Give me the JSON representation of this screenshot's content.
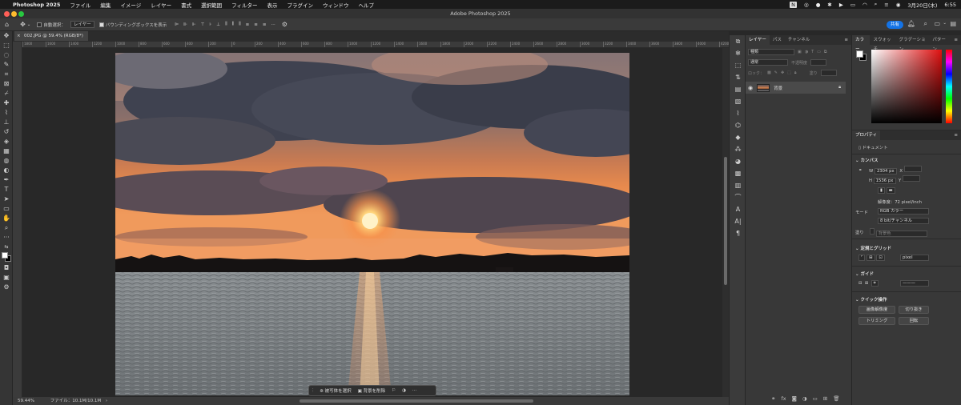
{
  "menubar": {
    "apple": "",
    "app": "Photoshop 2025",
    "items": [
      "ファイル",
      "編集",
      "イメージ",
      "レイヤー",
      "書式",
      "選択範囲",
      "フィルター",
      "表示",
      "プラグイン",
      "ウィンドウ",
      "ヘルプ"
    ],
    "date": "3月20日(木)",
    "time": "6:55"
  },
  "window": {
    "title": "Adobe Photoshop 2025"
  },
  "options": {
    "auto_select_label": "自動選択：",
    "layer_dropdown": "レイヤー",
    "bbox_label": "バウンディングボックスを表示",
    "share": "共有"
  },
  "document": {
    "tab": "002.JPG @ 59.4% (RGB/8*)"
  },
  "rulers": {
    "h": [
      "1800",
      "1600",
      "1400",
      "1200",
      "1000",
      "800",
      "600",
      "400",
      "200",
      "0",
      "200",
      "400",
      "600",
      "800",
      "1000",
      "1200",
      "1400",
      "1600",
      "1800",
      "2000",
      "2200",
      "2400",
      "2600",
      "2800",
      "3000",
      "3200",
      "3400",
      "3600",
      "3800",
      "4000",
      "4200"
    ]
  },
  "context_bar": {
    "select_subject": "被写体を選択",
    "remove_bg": "背景を削除"
  },
  "status": {
    "zoom": "59.44%",
    "file": "ファイル：10.1M/10.1M"
  },
  "layers_panel": {
    "tabs": [
      "レイヤー",
      "パス",
      "チャンネル"
    ],
    "kind": "種類",
    "blend": "通常",
    "opacity_label": "不透明度",
    "lock_label": "ロック：",
    "fill_label": "塗り",
    "layer_name": "背景"
  },
  "color_panel": {
    "tabs": [
      "カラー",
      "スウォッチ",
      "グラデーション",
      "パターン"
    ]
  },
  "properties": {
    "tab": "プロパティ",
    "doc_label": "ドキュメント",
    "canvas": "カンバス",
    "w_label": "W",
    "w": "2304 px",
    "x_label": "X",
    "h_label": "H",
    "h": "1536 px",
    "y_label": "Y",
    "resolution": "解像度：72 pixel/inch",
    "mode_label": "モード",
    "mode": "RGB カラー",
    "bits": "8 bit/チャンネル",
    "fill_label": "塗り",
    "fill": "背景色",
    "rulers_grids": "定規とグリッド",
    "units": "pixel",
    "guides": "ガイド",
    "quick_actions": "クイック操作",
    "btn_upscale": "画像解像度",
    "btn_crop": "切り抜き",
    "btn_trim": "トリミング",
    "btn_rotate": "回転"
  }
}
